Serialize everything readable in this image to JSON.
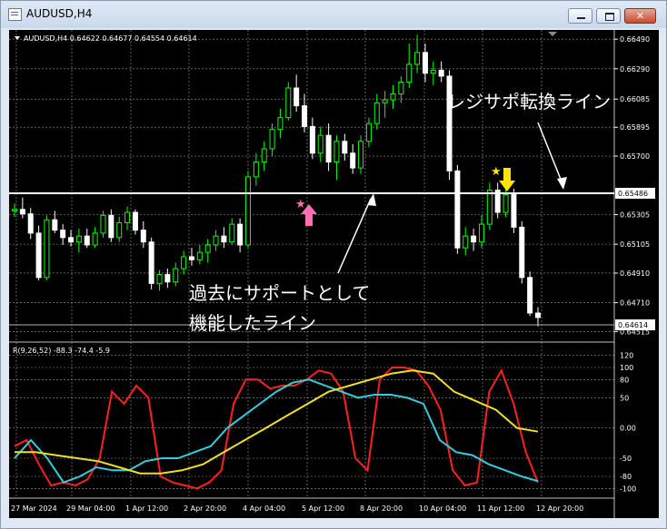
{
  "window": {
    "title": "AUDUSD,H4",
    "min_icon": "minimize-icon",
    "max_icon": "maximize-icon",
    "close_icon": "close-icon",
    "close_glyph": "✕"
  },
  "price_chart": {
    "header": "AUDUSD,H4  0.64622 0.64677 0.64554 0.64614",
    "price_labels": [
      "0.66490",
      "0.66290",
      "0.66085",
      "0.65895",
      "0.65700",
      "0.65305",
      "0.65105",
      "0.64910",
      "0.64710",
      "0.64515"
    ],
    "support_line_label": "0.65486",
    "last_price_label": "0.64614",
    "support_line_price": 0.65486,
    "annotation_top": "レジサポ転換ライン",
    "annotation_left_line1": "過去にサポートとして",
    "annotation_left_line2": "機能したライン",
    "colors": {
      "background": "#000000",
      "bull": "#00ff00",
      "bear": "#ffffff",
      "line": "#ffffff",
      "grid": "#a0a0a0",
      "pink": "#ff6eb4",
      "yellow": "#ffe400"
    }
  },
  "indicator": {
    "header": "R(9,26,52) -88.3 -74.4 -5.9",
    "values": [
      -88.3,
      -74.4,
      -5.9
    ],
    "scale_labels": [
      "120",
      "100",
      "80",
      "50",
      "0.00",
      "-50",
      "-80",
      "-100"
    ],
    "series_colors": {
      "fast": "#ff2020",
      "medium": "#30d0e0",
      "slow": "#f0e020"
    }
  },
  "time_axis": [
    "27 Mar 2024",
    "29 Mar 04:00",
    "1 Apr 12:00",
    "2 Apr 20:00",
    "4 Apr 04:00",
    "5 Apr 12:00",
    "8 Apr 20:00",
    "10 Apr 04:00",
    "11 Apr 12:00",
    "12 Apr 20:00"
  ],
  "chart_data": {
    "type": "candlestick",
    "symbol": "AUDUSD",
    "timeframe": "H4",
    "y_range": [
      0.6445,
      0.6654
    ],
    "ohlc_last": {
      "open": 0.64622,
      "high": 0.64677,
      "low": 0.64554,
      "close": 0.64614
    },
    "candles": [
      [
        0.6533,
        0.6538,
        0.6529,
        0.6534
      ],
      [
        0.6534,
        0.6542,
        0.6528,
        0.6531
      ],
      [
        0.6531,
        0.6535,
        0.6514,
        0.6518
      ],
      [
        0.6518,
        0.6523,
        0.6486,
        0.6488
      ],
      [
        0.6488,
        0.653,
        0.6486,
        0.6527
      ],
      [
        0.6527,
        0.6533,
        0.6518,
        0.652
      ],
      [
        0.652,
        0.6524,
        0.651,
        0.6515
      ],
      [
        0.6515,
        0.652,
        0.6509,
        0.6512
      ],
      [
        0.6512,
        0.6521,
        0.6505,
        0.6516
      ],
      [
        0.6516,
        0.6521,
        0.6508,
        0.651
      ],
      [
        0.651,
        0.6522,
        0.6508,
        0.6518
      ],
      [
        0.6518,
        0.6533,
        0.6515,
        0.653
      ],
      [
        0.653,
        0.6534,
        0.6512,
        0.6515
      ],
      [
        0.6515,
        0.6529,
        0.6512,
        0.6525
      ],
      [
        0.6525,
        0.6536,
        0.652,
        0.6532
      ],
      [
        0.6532,
        0.6534,
        0.6517,
        0.652
      ],
      [
        0.652,
        0.6526,
        0.6508,
        0.6512
      ],
      [
        0.6512,
        0.6515,
        0.648,
        0.6484
      ],
      [
        0.6484,
        0.6493,
        0.6479,
        0.649
      ],
      [
        0.649,
        0.6494,
        0.6481,
        0.6485
      ],
      [
        0.6485,
        0.6498,
        0.6482,
        0.6494
      ],
      [
        0.6494,
        0.6506,
        0.649,
        0.6502
      ],
      [
        0.6502,
        0.6508,
        0.6496,
        0.65
      ],
      [
        0.65,
        0.651,
        0.6497,
        0.6505
      ],
      [
        0.6505,
        0.6514,
        0.6498,
        0.651
      ],
      [
        0.651,
        0.652,
        0.6506,
        0.6516
      ],
      [
        0.6516,
        0.6522,
        0.6508,
        0.6512
      ],
      [
        0.6512,
        0.6528,
        0.651,
        0.6524
      ],
      [
        0.6524,
        0.6528,
        0.6505,
        0.651
      ],
      [
        0.651,
        0.656,
        0.6508,
        0.6556
      ],
      [
        0.6556,
        0.6572,
        0.655,
        0.6566
      ],
      [
        0.6566,
        0.658,
        0.656,
        0.6575
      ],
      [
        0.6575,
        0.6592,
        0.657,
        0.6588
      ],
      [
        0.6588,
        0.6602,
        0.6582,
        0.6596
      ],
      [
        0.6596,
        0.662,
        0.6594,
        0.6616
      ],
      [
        0.6616,
        0.6625,
        0.66,
        0.6604
      ],
      [
        0.6604,
        0.6612,
        0.6586,
        0.659
      ],
      [
        0.659,
        0.6596,
        0.6568,
        0.6572
      ],
      [
        0.6572,
        0.659,
        0.6566,
        0.6584
      ],
      [
        0.6584,
        0.6592,
        0.656,
        0.6566
      ],
      [
        0.6566,
        0.6584,
        0.6554,
        0.658
      ],
      [
        0.658,
        0.6585,
        0.6567,
        0.6572
      ],
      [
        0.6572,
        0.6578,
        0.6558,
        0.6562
      ],
      [
        0.6562,
        0.6584,
        0.6558,
        0.658
      ],
      [
        0.658,
        0.6596,
        0.6576,
        0.6592
      ],
      [
        0.6592,
        0.6612,
        0.6588,
        0.6606
      ],
      [
        0.6606,
        0.6614,
        0.6596,
        0.6608
      ],
      [
        0.6608,
        0.6618,
        0.6602,
        0.6612
      ],
      [
        0.6612,
        0.6624,
        0.6606,
        0.662
      ],
      [
        0.662,
        0.6646,
        0.6616,
        0.6632
      ],
      [
        0.6632,
        0.6652,
        0.6626,
        0.664
      ],
      [
        0.664,
        0.6646,
        0.662,
        0.6626
      ],
      [
        0.6626,
        0.6634,
        0.6618,
        0.6628
      ],
      [
        0.6628,
        0.6634,
        0.662,
        0.6624
      ],
      [
        0.6624,
        0.6628,
        0.6554,
        0.656
      ],
      [
        0.656,
        0.6564,
        0.6504,
        0.6508
      ],
      [
        0.6508,
        0.6522,
        0.6503,
        0.6516
      ],
      [
        0.6516,
        0.6521,
        0.6506,
        0.6512
      ],
      [
        0.6512,
        0.653,
        0.6508,
        0.6524
      ],
      [
        0.6524,
        0.6552,
        0.652,
        0.6547
      ],
      [
        0.6547,
        0.6552,
        0.6528,
        0.6532
      ],
      [
        0.6532,
        0.6548,
        0.6529,
        0.6544
      ],
      [
        0.6544,
        0.6548,
        0.6518,
        0.6522
      ],
      [
        0.6522,
        0.6526,
        0.6484,
        0.6488
      ],
      [
        0.6488,
        0.6492,
        0.6462,
        0.6464
      ],
      [
        0.6464,
        0.6468,
        0.6455,
        0.6461
      ]
    ],
    "indicator_series": [
      {
        "name": "fast",
        "values": [
          -30,
          -20,
          -60,
          -95,
          -90,
          -95,
          -85,
          -50,
          60,
          40,
          70,
          50,
          -80,
          -90,
          -95,
          -100,
          -90,
          -70,
          40,
          80,
          80,
          65,
          70,
          70,
          80,
          95,
          90,
          60,
          -50,
          -70,
          80,
          100,
          100,
          95,
          70,
          30,
          -70,
          -95,
          -90,
          60,
          95,
          40,
          -40,
          -90
        ]
      },
      {
        "name": "medium",
        "values": [
          -50,
          -20,
          -50,
          -90,
          -80,
          -65,
          -70,
          -70,
          -55,
          -50,
          -50,
          -40,
          -30,
          0,
          20,
          40,
          60,
          75,
          80,
          70,
          60,
          50,
          55,
          55,
          50,
          40,
          -20,
          -40,
          -45,
          -60,
          -70,
          -80,
          -88
        ]
      },
      {
        "name": "slow",
        "values": [
          -40,
          -40,
          -45,
          -50,
          -55,
          -65,
          -75,
          -75,
          -70,
          -60,
          -40,
          -20,
          0,
          20,
          40,
          60,
          70,
          80,
          90,
          95,
          90,
          60,
          45,
          30,
          0,
          -6
        ]
      }
    ]
  }
}
